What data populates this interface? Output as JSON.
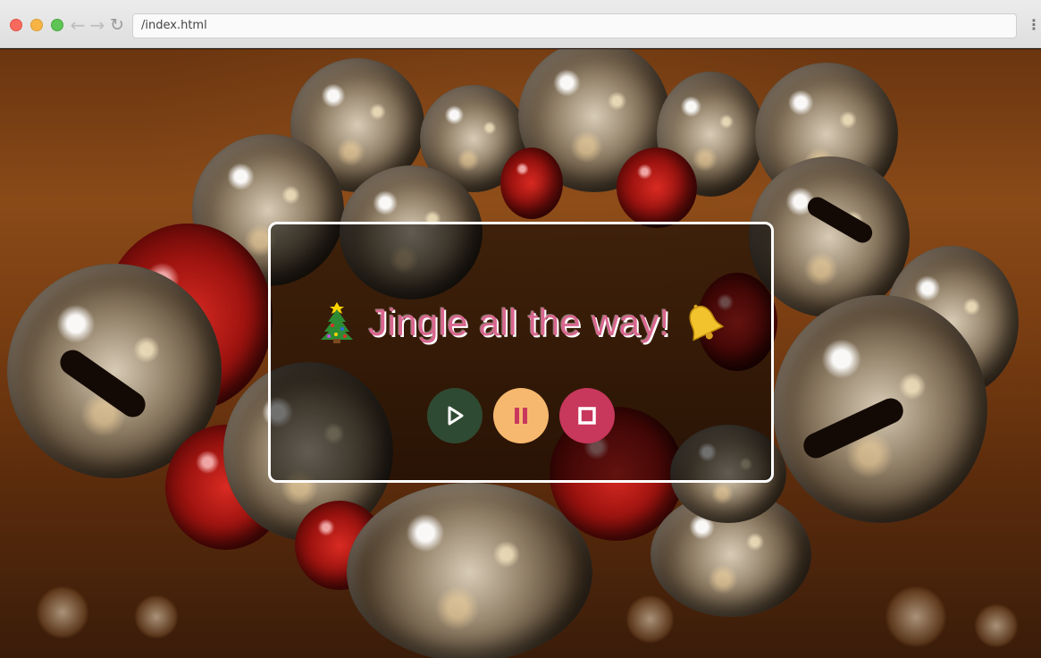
{
  "browser": {
    "url": "/index.html",
    "back_icon": "back-arrow-icon",
    "forward_icon": "forward-arrow-icon",
    "reload_icon": "reload-icon",
    "menu_icon": "kebab-menu-icon"
  },
  "card": {
    "title": "Jingle all the way!",
    "leading_emoji": "christmas-tree-icon",
    "trailing_emoji": "bell-icon",
    "title_color": "#d9678f"
  },
  "controls": [
    {
      "name": "play",
      "icon": "play-icon",
      "color": "#2f4a32"
    },
    {
      "name": "pause",
      "icon": "pause-icon",
      "color": "#f6b86e"
    },
    {
      "name": "stop",
      "icon": "stop-icon",
      "color": "#c8375c"
    }
  ]
}
